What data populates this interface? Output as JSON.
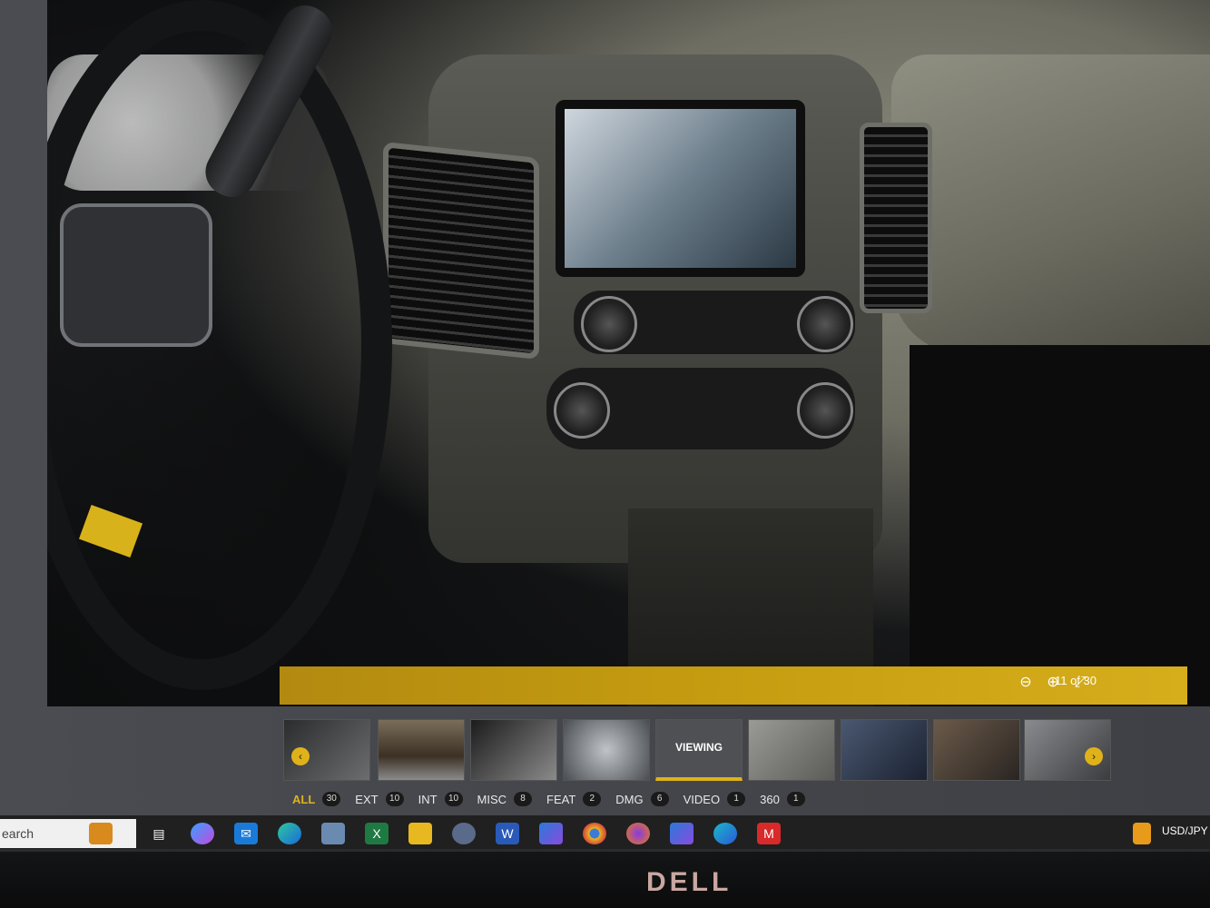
{
  "viewer": {
    "image_counter": "11 of 30",
    "active_thumb_label": "VIEWING"
  },
  "toolbar_icons": [
    "zoom-out-icon",
    "zoom-in-icon",
    "fullscreen-exit-icon"
  ],
  "filters": [
    {
      "label": "ALL",
      "count": "30",
      "active": true
    },
    {
      "label": "EXT",
      "count": "10",
      "active": false
    },
    {
      "label": "INT",
      "count": "10",
      "active": false
    },
    {
      "label": "MISC",
      "count": "8",
      "active": false
    },
    {
      "label": "FEAT",
      "count": "2",
      "active": false
    },
    {
      "label": "DMG",
      "count": "6",
      "active": false
    },
    {
      "label": "VIDEO",
      "count": "1",
      "active": false
    },
    {
      "label": "360",
      "count": "1",
      "active": false
    }
  ],
  "taskbar": {
    "search_text": "earch",
    "currency": "USD/JPY"
  },
  "monitor_brand": "DELL",
  "colors": {
    "accent": "#e0b21a",
    "toolbar": "#c69d10",
    "taskbar": "#202020"
  }
}
